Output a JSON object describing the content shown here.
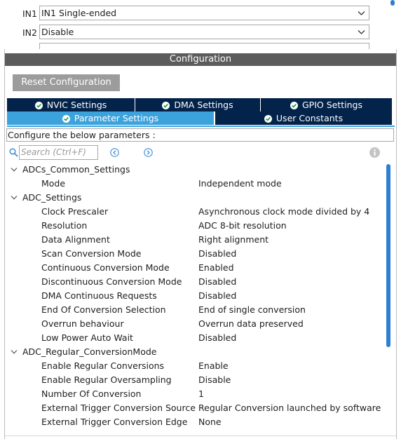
{
  "top_mode": {
    "rows": [
      {
        "label": "IN1",
        "value": "IN1 Single-ended"
      },
      {
        "label": "IN2",
        "value": "Disable"
      }
    ]
  },
  "config_title": "Configuration",
  "reset_button": "Reset Configuration",
  "tabs": {
    "nvic": "NVIC Settings",
    "dma": "DMA Settings",
    "gpio": "GPIO Settings",
    "parameter": "Parameter Settings",
    "user_constants": "User Constants"
  },
  "description": "Configure the below parameters :",
  "search": {
    "placeholder": "Search (Ctrl+F)"
  },
  "icons": {
    "search": "search-icon",
    "prev": "arrow-left-circle-icon",
    "next": "arrow-right-circle-icon",
    "info": "info-icon",
    "check": "check-circle-icon",
    "expand": "chevron-down-icon"
  },
  "colors": {
    "tab_dark": "#03234b",
    "tab_active": "#3ca2dc",
    "header_bar": "#5c5c5c",
    "scrollbar": "#2f7fd1"
  },
  "groups": [
    {
      "name": "ADCs_Common_Settings",
      "params": [
        {
          "name": "Mode",
          "value": "Independent mode"
        }
      ]
    },
    {
      "name": "ADC_Settings",
      "params": [
        {
          "name": "Clock Prescaler",
          "value": "Asynchronous clock mode divided by 4"
        },
        {
          "name": "Resolution",
          "value": "ADC 8-bit resolution"
        },
        {
          "name": "Data Alignment",
          "value": "Right alignment"
        },
        {
          "name": "Scan Conversion Mode",
          "value": "Disabled"
        },
        {
          "name": "Continuous Conversion Mode",
          "value": "Enabled"
        },
        {
          "name": "Discontinuous Conversion Mode",
          "value": "Disabled"
        },
        {
          "name": "DMA Continuous Requests",
          "value": "Disabled"
        },
        {
          "name": "End Of Conversion Selection",
          "value": "End of single conversion"
        },
        {
          "name": "Overrun behaviour",
          "value": "Overrun data preserved"
        },
        {
          "name": "Low Power Auto Wait",
          "value": "Disabled"
        }
      ]
    },
    {
      "name": "ADC_Regular_ConversionMode",
      "params": [
        {
          "name": "Enable Regular Conversions",
          "value": "Enable"
        },
        {
          "name": "Enable Regular Oversampling",
          "value": "Disable"
        },
        {
          "name": "Number Of Conversion",
          "value": "1"
        },
        {
          "name": "External Trigger Conversion Source",
          "value": "Regular Conversion launched by software"
        },
        {
          "name": "External Trigger Conversion Edge",
          "value": "None"
        }
      ]
    }
  ]
}
